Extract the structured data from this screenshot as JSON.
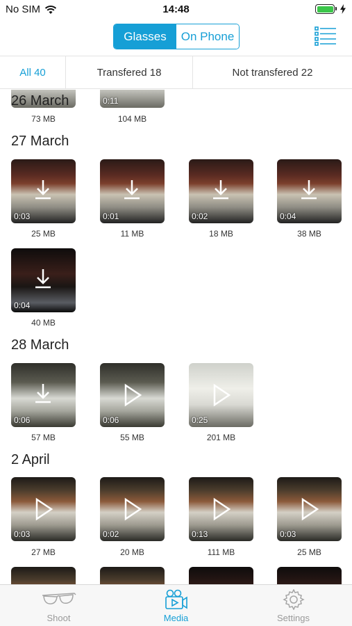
{
  "status": {
    "carrier": "No SIM",
    "time": "14:48"
  },
  "header": {
    "seg_active": "Glasses",
    "seg_inactive": "On Phone"
  },
  "filters": [
    {
      "label": "All 40"
    },
    {
      "label": "Transfered 18"
    },
    {
      "label": "Not transfered 22"
    }
  ],
  "groups": {
    "march26": {
      "date": "26 March",
      "items": [
        {
          "size": "73 MB",
          "duration": ""
        },
        {
          "size": "104 MB",
          "duration": "0:11"
        }
      ]
    },
    "march27": {
      "date": "27 March",
      "items": [
        {
          "size": "25 MB",
          "duration": "0:03",
          "state": "download"
        },
        {
          "size": "11 MB",
          "duration": "0:01",
          "state": "download"
        },
        {
          "size": "18 MB",
          "duration": "0:02",
          "state": "download"
        },
        {
          "size": "38 MB",
          "duration": "0:04",
          "state": "download"
        },
        {
          "size": "40 MB",
          "duration": "0:04",
          "state": "download"
        }
      ]
    },
    "march28": {
      "date": "28 March",
      "items": [
        {
          "size": "57 MB",
          "duration": "0:06",
          "state": "download"
        },
        {
          "size": "55 MB",
          "duration": "0:06",
          "state": "play"
        },
        {
          "size": "201 MB",
          "duration": "0:25",
          "state": "play"
        }
      ]
    },
    "april2": {
      "date": "2 April",
      "items": [
        {
          "size": "27 MB",
          "duration": "0:03",
          "state": "play"
        },
        {
          "size": "20 MB",
          "duration": "0:02",
          "state": "play"
        },
        {
          "size": "111 MB",
          "duration": "0:13",
          "state": "play"
        },
        {
          "size": "25 MB",
          "duration": "0:03",
          "state": "play"
        }
      ]
    }
  },
  "tabbar": [
    {
      "label": "Shoot",
      "icon": "glasses-icon"
    },
    {
      "label": "Media",
      "icon": "media-camera-icon"
    },
    {
      "label": "Settings",
      "icon": "gear-icon"
    }
  ],
  "colors": {
    "accent": "#169fd6",
    "inactive": "#999999"
  }
}
